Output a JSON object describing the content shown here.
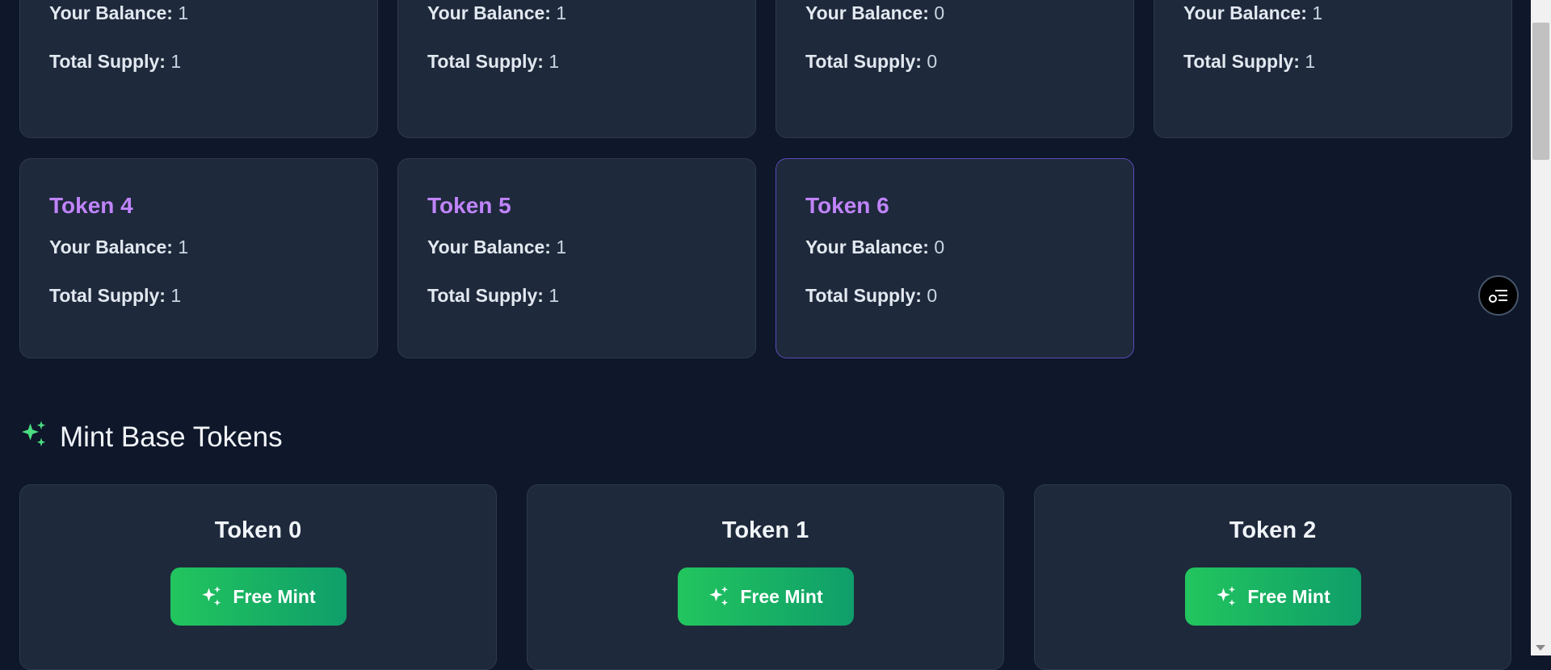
{
  "labels": {
    "balance": "Your Balance:",
    "supply": "Total Supply:"
  },
  "top_row": [
    {
      "balance": "1",
      "supply": "1"
    },
    {
      "balance": "1",
      "supply": "1"
    },
    {
      "balance": "0",
      "supply": "0"
    },
    {
      "balance": "1",
      "supply": "1"
    }
  ],
  "tokens": [
    {
      "name": "Token 4",
      "balance": "1",
      "supply": "1"
    },
    {
      "name": "Token 5",
      "balance": "1",
      "supply": "1"
    },
    {
      "name": "Token 6",
      "balance": "0",
      "supply": "0"
    }
  ],
  "mint_section": {
    "title": "Mint Base Tokens",
    "icon": "sparkles-icon",
    "button_label": "Free Mint",
    "tokens": [
      "Token 0",
      "Token 1",
      "Token 2"
    ]
  },
  "floating_button": {
    "icon": "list-settings-icon"
  },
  "colors": {
    "background": "#0f172a",
    "card": "#1e293b",
    "token_title": "#c084fc",
    "accent_green": "#22c55e"
  }
}
